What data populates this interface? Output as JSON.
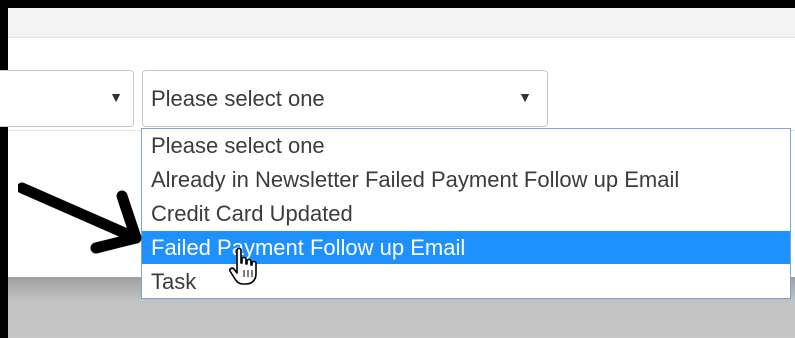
{
  "left_select": {
    "value": ""
  },
  "right_select": {
    "value": "Please select one"
  },
  "dropdown": {
    "options": [
      {
        "label": "Please select one"
      },
      {
        "label": "Already in Newsletter Failed Payment Follow up Email"
      },
      {
        "label": "Credit Card Updated"
      },
      {
        "label": "Failed Payment Follow up Email",
        "selected": true
      },
      {
        "label": "Task"
      }
    ]
  },
  "icons": {
    "caret": "▼",
    "annotation_arrow": "arrow-icon",
    "pointer": "hand-cursor-icon"
  },
  "colors": {
    "highlight": "#1e90ff",
    "dropdown_border": "#7aa7d8"
  }
}
